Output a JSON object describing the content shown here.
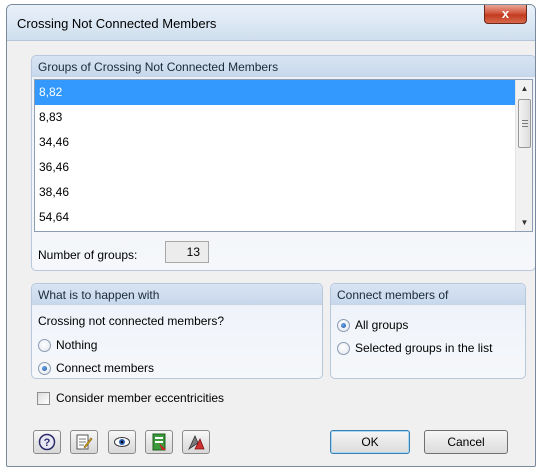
{
  "window": {
    "title": "Crossing Not Connected Members",
    "close_glyph": "x"
  },
  "groups_panel": {
    "header": "Groups of Crossing Not Connected Members",
    "items": [
      "8,82",
      "8,83",
      "34,46",
      "36,46",
      "38,46",
      "54,64"
    ],
    "selected_index": 0,
    "count_label": "Number of groups:",
    "count_value": "13"
  },
  "happen_panel": {
    "header": "What is to happen with",
    "question": "Crossing not connected members?",
    "options": [
      "Nothing",
      "Connect members"
    ],
    "selected": "Connect members"
  },
  "connect_panel": {
    "header": "Connect members of",
    "options": [
      "All groups",
      "Selected groups in the list"
    ],
    "selected": "All groups"
  },
  "eccentricities": {
    "label": "Consider member eccentricities",
    "checked": false
  },
  "toolbar": {
    "icons": [
      "help-icon",
      "edit-icon",
      "view-icon",
      "export-icon",
      "graphic-icon"
    ]
  },
  "buttons": {
    "ok": "OK",
    "cancel": "Cancel"
  },
  "colors": {
    "selection": "#3399ff",
    "title_bar": "#dce8f4",
    "close_button": "#c23a1f"
  }
}
